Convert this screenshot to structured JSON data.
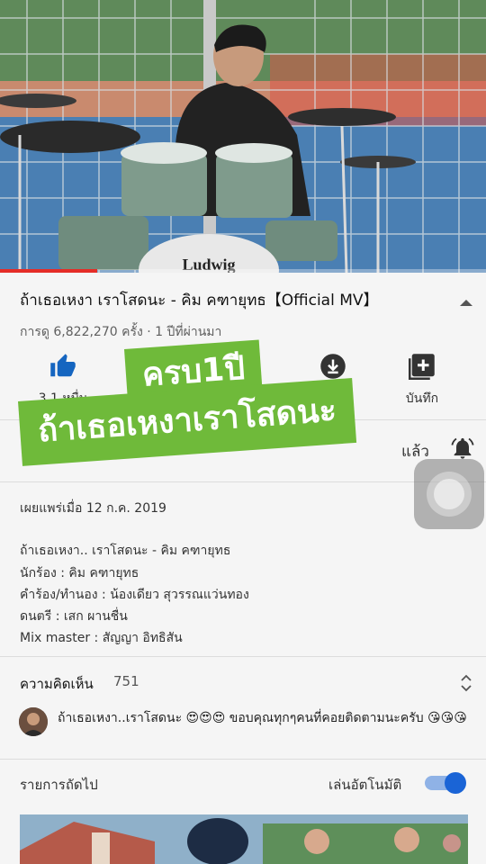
{
  "video": {
    "progress": 0.2,
    "drum_brand": "Ludwig"
  },
  "info": {
    "title": "ถ้าเธอเหงา เราโสดนะ - คิม คฑายุทธ【Official MV】",
    "meta": "การดู 6,822,270 ครั้ง · 1 ปีที่ผ่านมา"
  },
  "actions": [
    {
      "icon": "thumbs-up-icon",
      "label": "3.1 หมื่น"
    },
    {
      "icon": "download-icon",
      "label": ""
    },
    {
      "icon": "save-playlist-icon",
      "label": "บันทึก"
    }
  ],
  "overlay": {
    "line1": "ครบ1ปี",
    "line2": "ถ้าเธอเหงาเราโสดนะ"
  },
  "channel": {
    "subscribed_label": "แล้ว"
  },
  "description": {
    "published": "เผยแพร่เมื่อ 12 ก.ค. 2019",
    "lines": [
      "ถ้าเธอเหงา.. เราโสดนะ - คิม คฑายุทธ",
      "นักร้อง : คิม คฑายุทธ",
      "คำร้อง/ทำนอง : น้องเดียว สุวรรณแว่นทอง",
      "ดนตรี : เสก ผานชื่น",
      "Mix master : สัญญา อิทธิสัน"
    ]
  },
  "comments": {
    "title": "ความคิดเห็น",
    "count": "751",
    "top_comment": "ถ้าเธอเหงา..เราโสดนะ 😍😍😍 ขอบคุณทุกๆคนที่คอยติดตามนะครับ 😘😘😘"
  },
  "up_next": {
    "title": "รายการถัดไป",
    "autoplay_label": "เล่นอัตโนมัติ",
    "autoplay_on": true
  },
  "colors": {
    "accent_blue": "#1a64d6",
    "progress_red": "#e52d27",
    "overlay_green": "#6fba3a"
  }
}
